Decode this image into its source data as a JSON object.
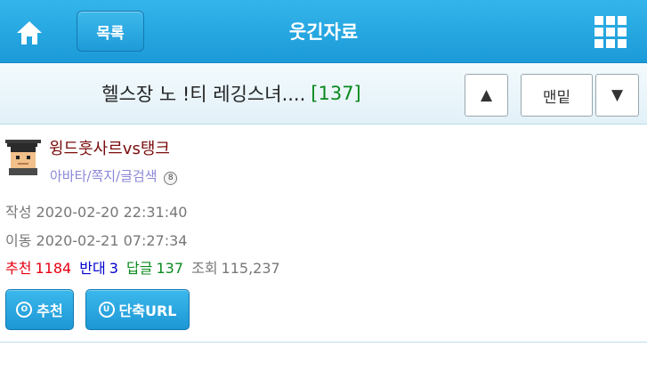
{
  "header": {
    "list_label": "목록",
    "title": "웃긴자료"
  },
  "subheader": {
    "post_title": "헬스장 노  !티 레깅스녀....",
    "reply_count": "[137]",
    "up_label": "▲",
    "bottom_label": "맨밑",
    "down_label": "▼"
  },
  "author": {
    "nickname": "윙드훗사르vs탱크",
    "links": "아바타/쪽지/글검색",
    "links_badge": "8"
  },
  "meta": {
    "written_label": "작성",
    "written_value": "2020-02-20 22:31:40",
    "moved_label": "이동",
    "moved_value": "2020-02-21 07:27:34"
  },
  "stats": {
    "recommend_label": "추천",
    "recommend_value": "1184",
    "oppose_label": "반대",
    "oppose_value": "3",
    "reply_label": "답글",
    "reply_value": "137",
    "view_label": "조회",
    "view_value": "115,237"
  },
  "actions": {
    "recommend_icon": "O",
    "recommend_label": "추천",
    "shorturl_icon": "U",
    "shorturl_label": "단축URL"
  },
  "colors": {
    "header_blue": "#1b9ad8",
    "nickname": "#7a0c0c",
    "recommend": "#e60012",
    "oppose": "#0000d0",
    "reply": "#0b8a1f"
  },
  "icons": {
    "home": "home-icon",
    "menu": "grid-menu-icon",
    "avatar": "pixel-avatar"
  }
}
